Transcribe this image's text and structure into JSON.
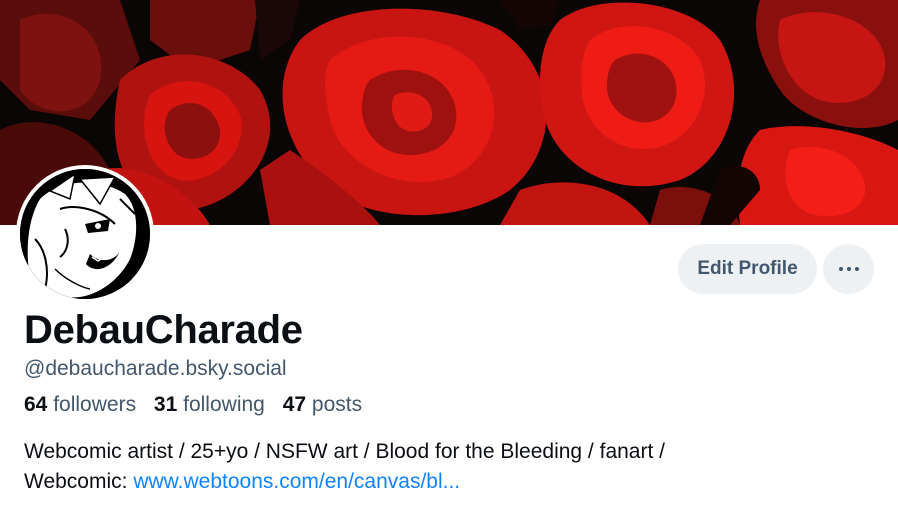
{
  "profile": {
    "display_name": "DebauCharade",
    "handle": "@debaucharade.bsky.social",
    "stats": {
      "followers_count": "64",
      "followers_label": "followers",
      "following_count": "31",
      "following_label": "following",
      "posts_count": "47",
      "posts_label": "posts"
    },
    "bio_line1": "Webcomic artist / 25+yo / NSFW art / Blood for the Bleeding / fanart /",
    "bio_line2_prefix": "Webcomic: ",
    "bio_link": "www.webtoons.com/en/canvas/bl..."
  },
  "actions": {
    "edit_profile_label": "Edit Profile",
    "more_icon": "ellipsis-icon"
  },
  "colors": {
    "accent_link": "#1083fe",
    "secondary_text": "#42576c",
    "button_bg": "#eef1f4",
    "banner_red": "#d81410"
  }
}
